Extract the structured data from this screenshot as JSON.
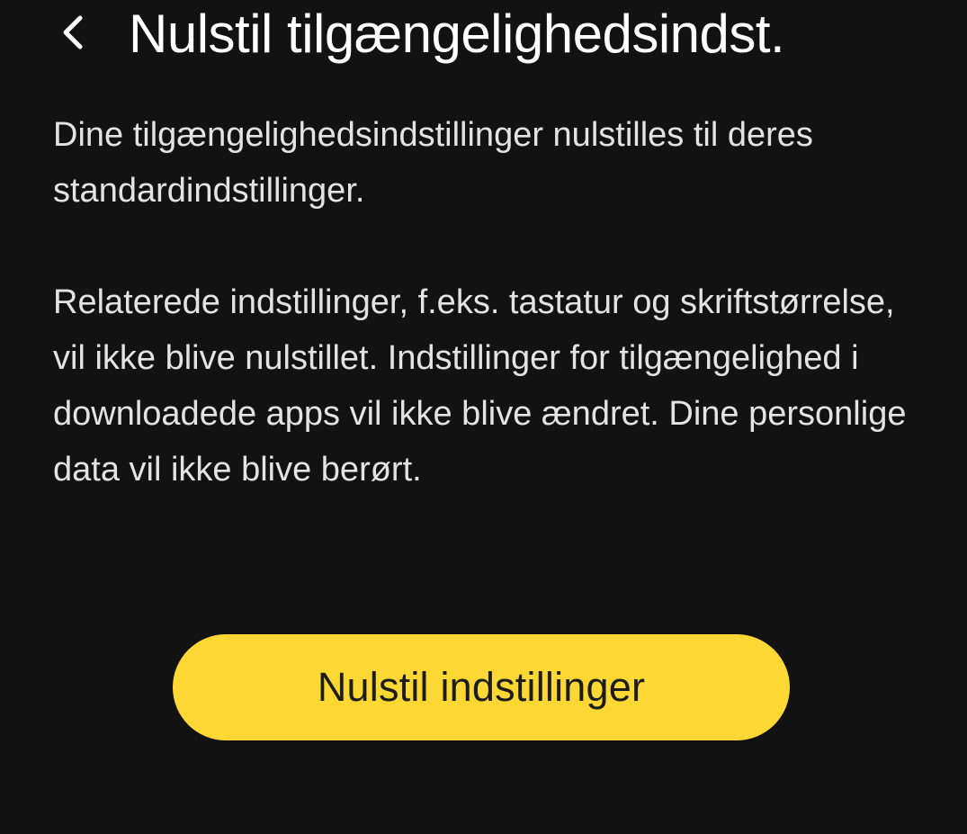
{
  "header": {
    "back_icon": "chevron-left-icon",
    "title": "Nulstil tilgængelighedsindst."
  },
  "content": {
    "paragraph_1": "Dine tilgængelighedsindstillinger nulstilles til deres standardindstillinger.",
    "paragraph_2": "Relaterede indstillinger, f.eks. tastatur og skriftstørrelse, vil ikke blive nulstillet. Indstillinger for tilgængelighed i downloadede apps vil ikke blive ændret. Dine personlige data vil ikke blive berørt."
  },
  "actions": {
    "reset_label": "Nulstil indstillinger"
  },
  "colors": {
    "background": "#121212",
    "accent": "#fdd835",
    "text": "#e3e3e3"
  }
}
